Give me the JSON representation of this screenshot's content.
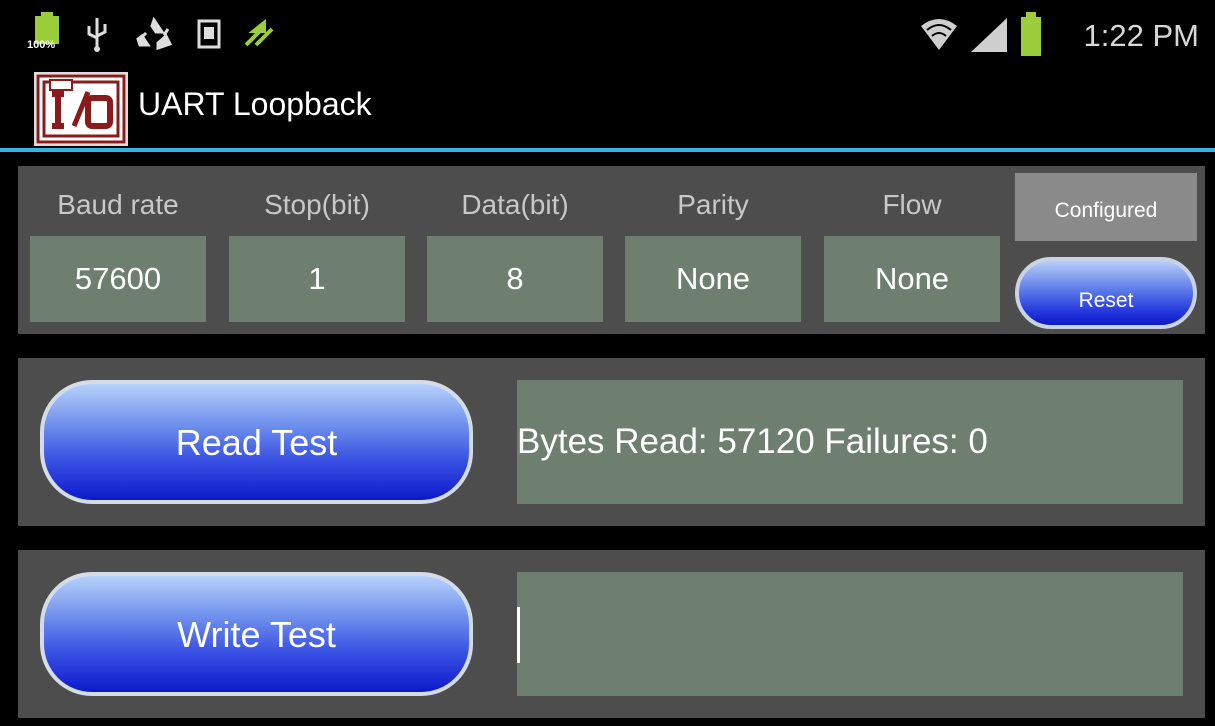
{
  "status_bar": {
    "battery_level": "100%",
    "time": "1:22 PM",
    "left_icons": [
      "battery-icon",
      "usb-icon",
      "recycle-icon",
      "sd-card-icon",
      "sync-arrow-icon"
    ],
    "right_icons": [
      "wifi-icon",
      "signal-icon",
      "battery-full-icon"
    ],
    "accent_green": "#9ccd3a"
  },
  "action_bar": {
    "title": "UART Loopback",
    "logo_icon": "io-logo-icon",
    "underline_color": "#33b5e5"
  },
  "config": {
    "labels": {
      "baud": "Baud rate",
      "stop": "Stop(bit)",
      "data": "Data(bit)",
      "parity": "Parity",
      "flow": "Flow"
    },
    "values": {
      "baud": "57600",
      "stop": "1",
      "data": "8",
      "parity": "None",
      "flow": "None"
    },
    "configured_label": "Configured",
    "reset_label": "Reset"
  },
  "read_test": {
    "button_label": "Read Test",
    "result": "Bytes Read: 57120 Failures: 0"
  },
  "write_test": {
    "button_label": "Write Test",
    "result": ""
  },
  "colors": {
    "panel_bg": "#4d4d4d",
    "value_bg": "#6f7f6f",
    "button_blue": "#2a3ee0"
  }
}
